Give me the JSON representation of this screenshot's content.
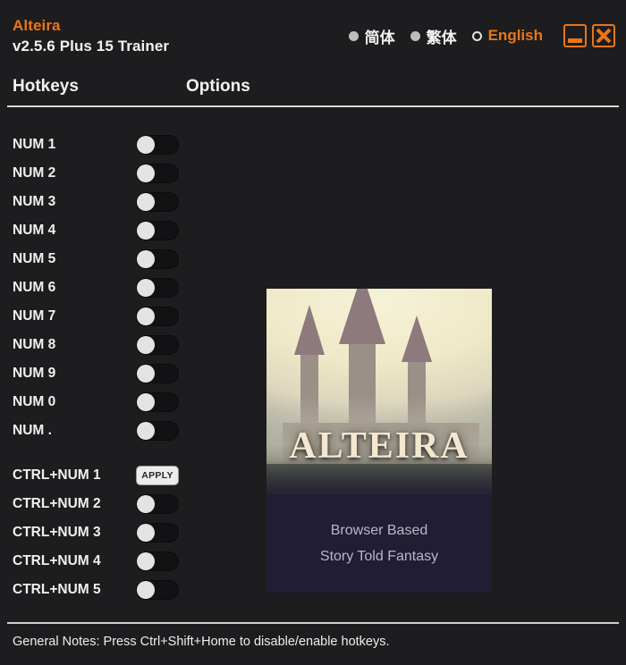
{
  "titlebar": {
    "app_name": "Alteira",
    "version": "v2.5.6 Plus 15 Trainer",
    "accent_color": "#e8761a",
    "languages": [
      {
        "label": "简体",
        "selected": false
      },
      {
        "label": "繁体",
        "selected": false
      },
      {
        "label": "English",
        "selected": true
      }
    ],
    "minimize_icon": "minimize-icon",
    "close_icon": "close-icon"
  },
  "columns": {
    "hotkeys": "Hotkeys",
    "options": "Options"
  },
  "rows": [
    {
      "hotkey": "NUM 1",
      "control": "toggle",
      "state": "off"
    },
    {
      "hotkey": "NUM 2",
      "control": "toggle",
      "state": "off"
    },
    {
      "hotkey": "NUM 3",
      "control": "toggle",
      "state": "off"
    },
    {
      "hotkey": "NUM 4",
      "control": "toggle",
      "state": "off"
    },
    {
      "hotkey": "NUM 5",
      "control": "toggle",
      "state": "off"
    },
    {
      "hotkey": "NUM 6",
      "control": "toggle",
      "state": "off"
    },
    {
      "hotkey": "NUM 7",
      "control": "toggle",
      "state": "off"
    },
    {
      "hotkey": "NUM 8",
      "control": "toggle",
      "state": "off"
    },
    {
      "hotkey": "NUM 9",
      "control": "toggle",
      "state": "off"
    },
    {
      "hotkey": "NUM 0",
      "control": "toggle",
      "state": "off"
    },
    {
      "hotkey": "NUM .",
      "control": "toggle",
      "state": "off"
    },
    {
      "hotkey": "CTRL+NUM 1",
      "control": "button",
      "label": "APPLY",
      "gap_before": true
    },
    {
      "hotkey": "CTRL+NUM 2",
      "control": "toggle",
      "state": "off"
    },
    {
      "hotkey": "CTRL+NUM 3",
      "control": "toggle",
      "state": "off"
    },
    {
      "hotkey": "CTRL+NUM 4",
      "control": "toggle",
      "state": "off"
    },
    {
      "hotkey": "CTRL+NUM 5",
      "control": "toggle",
      "state": "off"
    }
  ],
  "cover": {
    "logo": "ALTEIRA",
    "tagline_line1": "Browser Based",
    "tagline_line2": "Story Told Fantasy"
  },
  "footer": {
    "note": "General Notes: Press Ctrl+Shift+Home to disable/enable hotkeys."
  }
}
